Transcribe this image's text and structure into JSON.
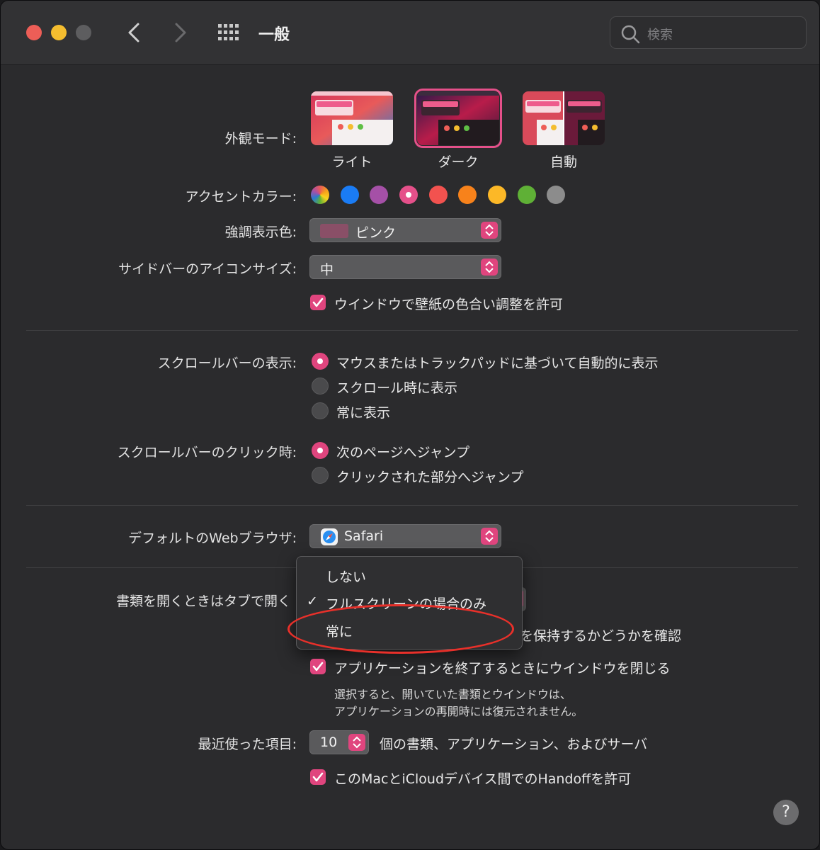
{
  "window": {
    "title": "一般"
  },
  "search": {
    "placeholder": "検索"
  },
  "appearance": {
    "label": "外観モード:",
    "options": [
      "ライト",
      "ダーク",
      "自動"
    ],
    "selected": "ダーク"
  },
  "accent": {
    "label": "アクセントカラー:",
    "colors": [
      "#multicolor",
      "#1a7cf5",
      "#a550a7",
      "#e5508a",
      "#f2524f",
      "#f7821b",
      "#fcb827",
      "#5fb036",
      "#8c8c8c"
    ],
    "selected_index": 3
  },
  "highlight": {
    "label": "強調表示色:",
    "value": "ピンク",
    "chip_color": "#8a4f67"
  },
  "sidebar_icon": {
    "label": "サイドバーのアイコンサイズ:",
    "value": "中"
  },
  "wallpaper_tint": {
    "label": "ウインドウで壁紙の色合い調整を許可",
    "checked": true
  },
  "scrollbar_show": {
    "label": "スクロールバーの表示:",
    "options": [
      "マウスまたはトラックパッドに基づいて自動的に表示",
      "スクロール時に表示",
      "常に表示"
    ],
    "selected_index": 0
  },
  "scrollbar_click": {
    "label": "スクロールバーのクリック時:",
    "options": [
      "次のページへジャンプ",
      "クリックされた部分へジャンプ"
    ],
    "selected_index": 0
  },
  "browser": {
    "label": "デフォルトのWebブラウザ:",
    "value": "Safari"
  },
  "tabs": {
    "label": "書類を開くときはタブで開く"
  },
  "tabs_menu": {
    "items": [
      "しない",
      "フルスクリーンの場合のみ",
      "常に"
    ],
    "checked_index": 1
  },
  "ask_keep": {
    "label_fragment": "を保持するかどうかを確認"
  },
  "close_windows": {
    "label": "アプリケーションを終了するときにウインドウを閉じる",
    "checked": true,
    "note_line1": "選択すると、開いていた書類とウインドウは、",
    "note_line2": "アプリケーションの再開時には復元されません。"
  },
  "recent": {
    "label": "最近使った項目:",
    "value": "10",
    "suffix": "個の書類、アプリケーション、およびサーバ"
  },
  "handoff": {
    "label": "このMacとiCloudデバイス間でのHandoffを許可",
    "checked": true
  },
  "help": {
    "label": "?"
  },
  "colors": {
    "accent": "#e0457e",
    "annotation": "#e8302a"
  }
}
